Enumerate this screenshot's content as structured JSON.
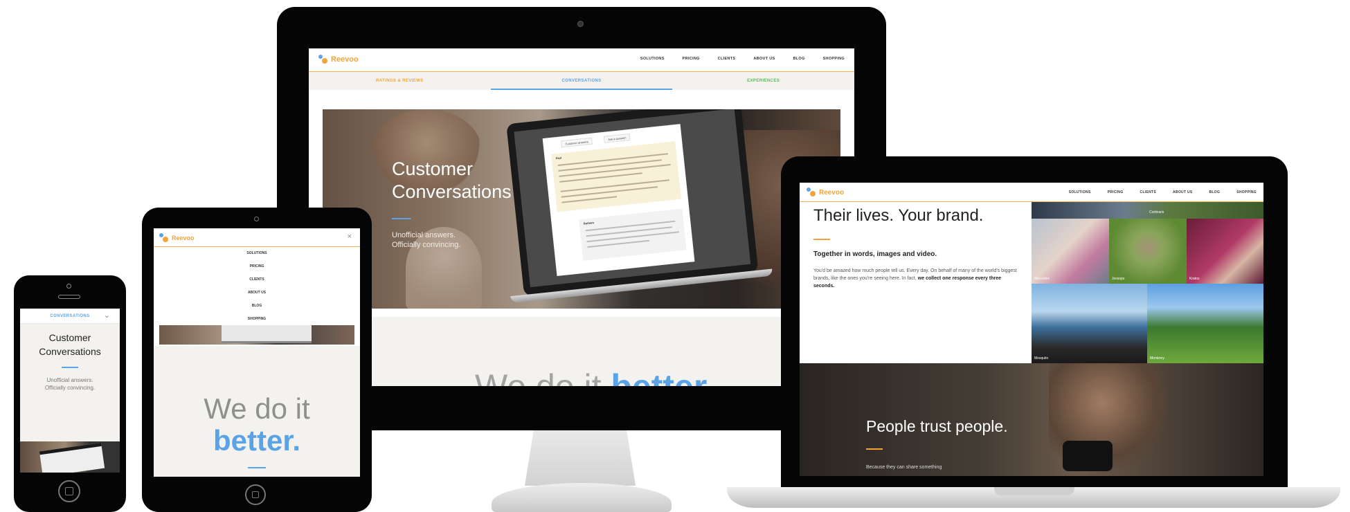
{
  "brand": {
    "name": "Reevoo",
    "colors": {
      "orange": "#f2a43a",
      "blue": "#5aa3e6",
      "green": "#5cb85c",
      "dark": "#050505"
    }
  },
  "nav": {
    "items": [
      "SOLUTIONS",
      "PRICING",
      "CLIENTS",
      "ABOUT US",
      "BLOG",
      "SHOPPING"
    ]
  },
  "monitor": {
    "subnav": [
      "RATINGS & REVIEWS",
      "CONVERSATIONS",
      "EXPERIENCES"
    ],
    "hero": {
      "title_line1": "Customer",
      "title_line2": "Conversations",
      "sub_line1": "Unofficial answers.",
      "sub_line2": "Officially convincing."
    },
    "inner_laptop": {
      "tab1": "Customer answers",
      "tab2": "Ask a question",
      "asker": "Paul",
      "answerer": "Barbara"
    },
    "tagline_plain": "We do it",
    "tagline_accent": "better"
  },
  "tablet": {
    "close_icon": "close-icon",
    "tagline_plain": "We do it",
    "tagline_accent": "better."
  },
  "phone": {
    "tab_label": "CONVERSATIONS",
    "chevron_icon": "chevron-down-icon",
    "title_line1": "Customer",
    "title_line2": "Conversations",
    "sub_line1": "Unofficial answers.",
    "sub_line2": "Officially convincing."
  },
  "laptop": {
    "headline": "Their lives. Your brand.",
    "subhead": "Together in words, images and video.",
    "body_line1": "You'd be amazed how much people tell us. Every day. On behalf of many of the world's",
    "body_line2": "biggest brands, like the ones you're seeing here. In fact,",
    "body_strong": "we collect one response every three seconds.",
    "tile_captions": [
      "Cortinaris",
      "Mercedes",
      "Jessops",
      "Kratos",
      "Mosquito",
      "Monterey",
      "Kingston"
    ],
    "trust_title": "People trust people.",
    "trust_sub": "Because they can share something"
  }
}
